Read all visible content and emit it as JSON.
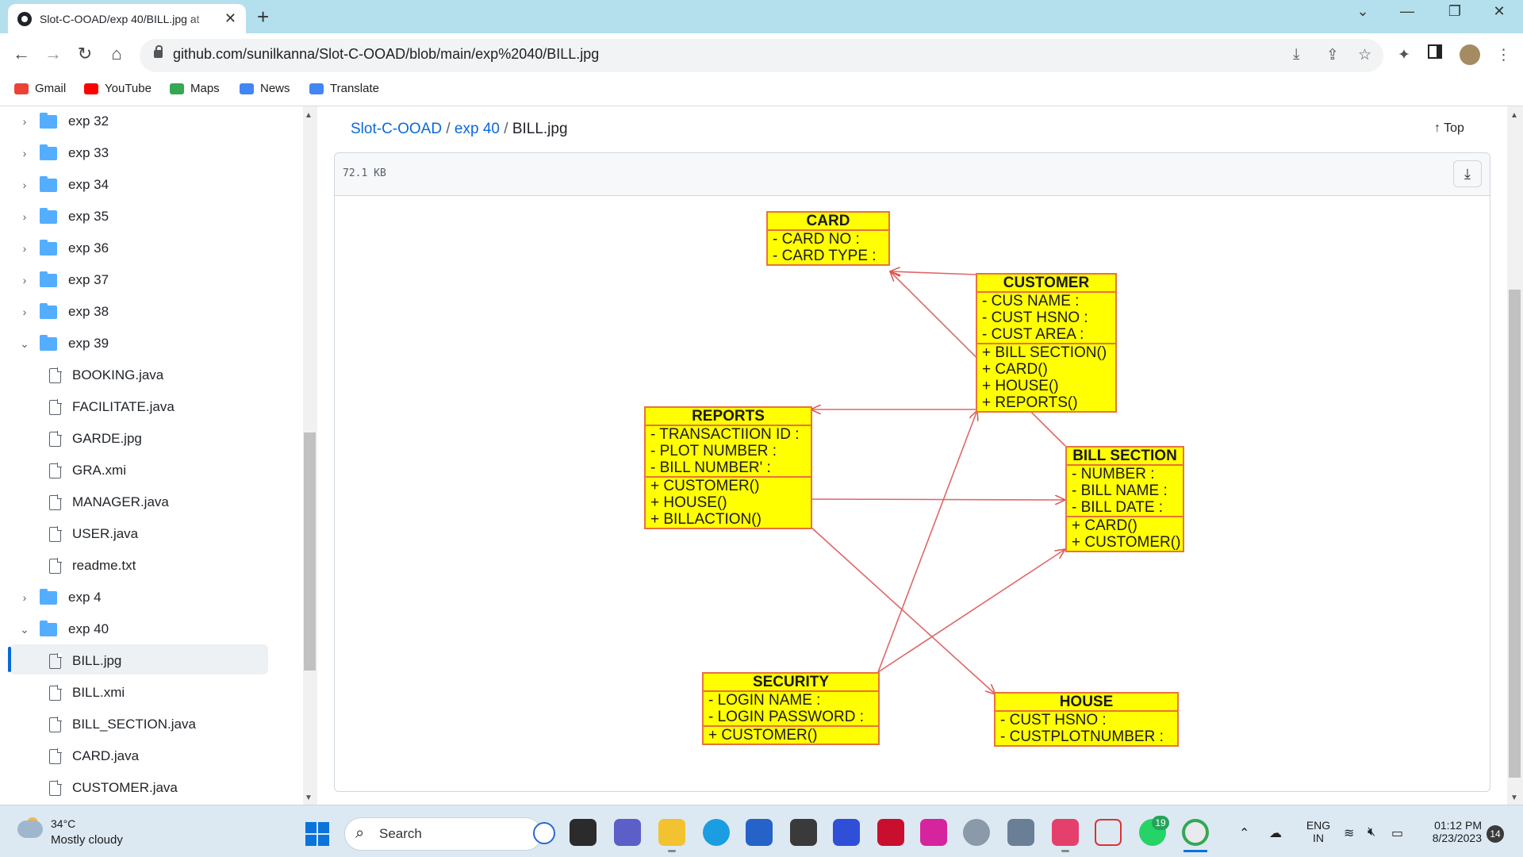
{
  "browser": {
    "tab_title": "Slot-C-OOAD/exp 40/BILL.jpg at",
    "tab_close": "✕",
    "new_tab": "+",
    "url": "github.com/sunilkanna/Slot-C-OOAD/blob/main/exp%2040/BILL.jpg",
    "window": {
      "minimize": "—",
      "maximize": "❐",
      "close": "✕",
      "tablist": "⌄"
    },
    "bookmarks": [
      {
        "label": "Gmail",
        "color": "#ea4335"
      },
      {
        "label": "YouTube",
        "color": "#ff0000"
      },
      {
        "label": "Maps",
        "color": "#34a853"
      },
      {
        "label": "News",
        "color": "#4285f4"
      },
      {
        "label": "Translate",
        "color": "#4285f4"
      }
    ]
  },
  "sidebar": {
    "items": [
      {
        "type": "folder",
        "label": "exp 32",
        "expanded": false
      },
      {
        "type": "folder",
        "label": "exp 33",
        "expanded": false
      },
      {
        "type": "folder",
        "label": "exp 34",
        "expanded": false
      },
      {
        "type": "folder",
        "label": "exp 35",
        "expanded": false
      },
      {
        "type": "folder",
        "label": "exp 36",
        "expanded": false
      },
      {
        "type": "folder",
        "label": "exp 37",
        "expanded": false
      },
      {
        "type": "folder",
        "label": "exp 38",
        "expanded": false
      },
      {
        "type": "folder",
        "label": "exp 39",
        "expanded": true
      },
      {
        "type": "file",
        "label": "BOOKING.java"
      },
      {
        "type": "file",
        "label": "FACILITATE.java"
      },
      {
        "type": "file",
        "label": "GARDE.jpg"
      },
      {
        "type": "file",
        "label": "GRA.xmi"
      },
      {
        "type": "file",
        "label": "MANAGER.java"
      },
      {
        "type": "file",
        "label": "USER.java"
      },
      {
        "type": "file",
        "label": "readme.txt"
      },
      {
        "type": "folder",
        "label": "exp 4",
        "expanded": false
      },
      {
        "type": "folder",
        "label": "exp 40",
        "expanded": true
      },
      {
        "type": "file",
        "label": "BILL.jpg",
        "selected": true
      },
      {
        "type": "file",
        "label": "BILL.xmi"
      },
      {
        "type": "file",
        "label": "BILL_SECTION.java"
      },
      {
        "type": "file",
        "label": "CARD.java"
      },
      {
        "type": "file",
        "label": "CUSTOMER.java"
      }
    ]
  },
  "main": {
    "breadcrumb": {
      "repo": "Slot-C-OOAD",
      "sep1": "/",
      "folder": "exp 40",
      "sep2": "/",
      "file": "BILL.jpg"
    },
    "top_label": "Top",
    "file_size": "72.1 KB"
  },
  "uml": {
    "card": {
      "title": "CARD",
      "attrs": [
        "- CARD NO :",
        "- CARD TYPE :"
      ]
    },
    "customer": {
      "title": "CUSTOMER",
      "attrs": [
        "- CUS NAME :",
        "- CUST HSNO :",
        "- CUST AREA :"
      ],
      "ops": [
        "+ BILL SECTION()",
        "+ CARD()",
        "+ HOUSE()",
        "+ REPORTS()"
      ]
    },
    "reports": {
      "title": "REPORTS",
      "attrs": [
        "- TRANSACTIION ID :",
        "- PLOT NUMBER :",
        "- BILL NUMBER' :"
      ],
      "ops": [
        "+ CUSTOMER()",
        "+ HOUSE()",
        "+ BILLACTION()"
      ]
    },
    "bill_section": {
      "title": "BILL SECTION",
      "attrs": [
        "- NUMBER :",
        "- BILL NAME :",
        "- BILL DATE :"
      ],
      "ops": [
        "+ CARD()",
        "+ CUSTOMER()"
      ]
    },
    "security": {
      "title": "SECURITY",
      "attrs": [
        "- LOGIN NAME :",
        "- LOGIN PASSWORD :"
      ],
      "ops": [
        "+ CUSTOMER()"
      ]
    },
    "house": {
      "title": "HOUSE",
      "attrs": [
        "- CUST HSNO :",
        "- CUSTPLOTNUMBER :"
      ]
    }
  },
  "taskbar": {
    "weather_temp": "34°C",
    "weather_desc": "Mostly cloudy",
    "search_label": "Search",
    "lang1": "ENG",
    "lang2": "IN",
    "time": "01:12 PM",
    "date": "8/23/2023",
    "whatsapp_badge": "19",
    "notif_count": "14"
  }
}
